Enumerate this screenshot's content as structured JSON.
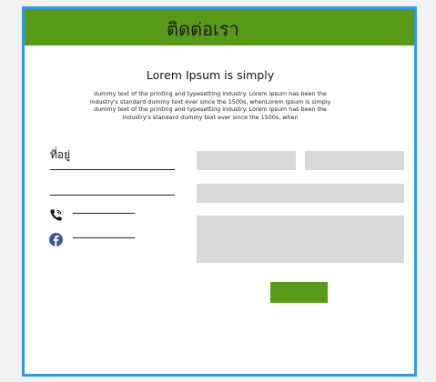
{
  "header": {
    "title": "ติดต่อเรา"
  },
  "headline": "Lorem Ipsum is simply",
  "body_text": "dummy text of the printing and typesetting industry. Lorem Ipsum has been the industry's standard dummy text ever since the 1500s, whenLorem Ipsum is simply dummy text of the printing and typesetting industry. Lorem Ipsum has been the industry's standard dummy text ever since the 1500s, when",
  "contact": {
    "address_label": "ที่อยู่"
  },
  "icons": {
    "phone": "phone-icon",
    "facebook": "facebook-icon"
  },
  "colors": {
    "header": "#5a9a1b",
    "border": "#2d9be8",
    "input": "#d9d9d9",
    "button": "#5a9a1b",
    "facebook": "#3b5998"
  }
}
